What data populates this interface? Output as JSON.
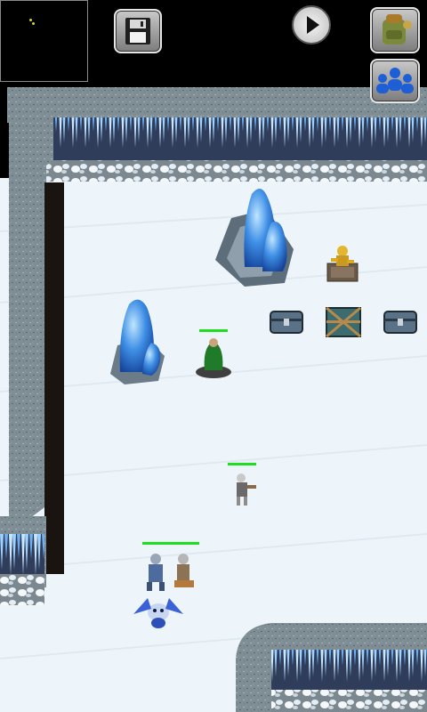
{
  "colors": {
    "snow": "#eef5fa",
    "wall_stone": "#7f8e95",
    "ice_crystal": "#3f8fe6",
    "health_bar": "#1ddf1d",
    "void": "#000000"
  },
  "hud": {
    "minimap_icon": "minimap",
    "save_icon": "floppy-disk-icon",
    "play_icon": "play-icon",
    "inventory_icon": "backpack-icon",
    "party_icon": "party-members-icon"
  },
  "units": [
    {
      "id": "green-cloaked-mage",
      "health": 1.0
    },
    {
      "id": "skeleton-warrior",
      "health": 1.0
    },
    {
      "id": "armored-knight-party",
      "health": 1.0
    },
    {
      "id": "blue-ice-drake",
      "health": null
    }
  ],
  "objects": [
    "ice-crystal-large",
    "ice-crystal-small",
    "golden-statue",
    "treasure-chest-left",
    "wooden-crate",
    "treasure-chest-right"
  ]
}
